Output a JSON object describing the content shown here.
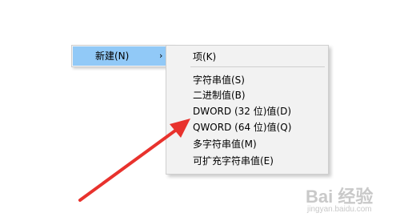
{
  "parent_menu": {
    "label": "新建(N)",
    "arrow": "›"
  },
  "submenu": {
    "items": [
      {
        "label": "项(K)"
      },
      {
        "label": "字符串值(S)"
      },
      {
        "label": "二进制值(B)"
      },
      {
        "label": "DWORD (32 位)值(D)"
      },
      {
        "label": "QWORD (64 位)值(Q)"
      },
      {
        "label": "多字符串值(M)"
      },
      {
        "label": "可扩充字符串值(E)"
      }
    ]
  },
  "annotation": {
    "color": "#e8322d"
  },
  "watermark": {
    "main": "Bai 经验",
    "sub": "jingyan.baidu.com"
  }
}
